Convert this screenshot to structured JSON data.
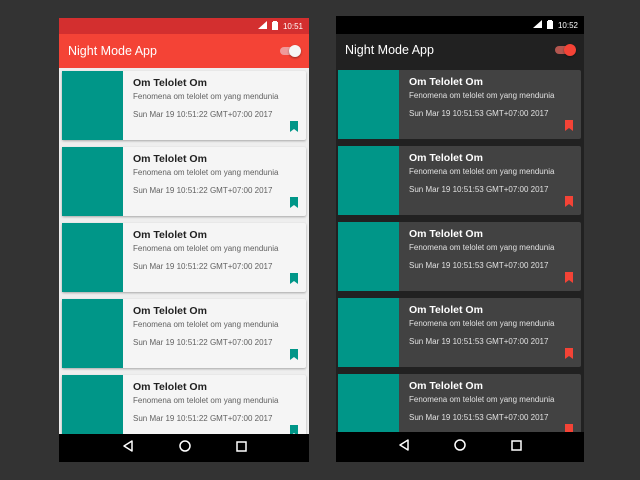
{
  "light": {
    "status_time": "10:51",
    "app_title": "Night Mode App",
    "cards": [
      {
        "title": "Om Telolet Om",
        "desc": "Fenomena om telolet om yang mendunia",
        "date": "Sun Mar 19 10:51:22 GMT+07:00 2017"
      },
      {
        "title": "Om Telolet Om",
        "desc": "Fenomena om telolet om yang mendunia",
        "date": "Sun Mar 19 10:51:22 GMT+07:00 2017"
      },
      {
        "title": "Om Telolet Om",
        "desc": "Fenomena om telolet om yang mendunia",
        "date": "Sun Mar 19 10:51:22 GMT+07:00 2017"
      },
      {
        "title": "Om Telolet Om",
        "desc": "Fenomena om telolet om yang mendunia",
        "date": "Sun Mar 19 10:51:22 GMT+07:00 2017"
      },
      {
        "title": "Om Telolet Om",
        "desc": "Fenomena om telolet om yang mendunia",
        "date": "Sun Mar 19 10:51:22 GMT+07:00 2017"
      }
    ]
  },
  "dark": {
    "status_time": "10:52",
    "app_title": "Night Mode App",
    "cards": [
      {
        "title": "Om Telolet Om",
        "desc": "Fenomena om telolet om yang mendunia",
        "date": "Sun Mar 19 10:51:53 GMT+07:00 2017"
      },
      {
        "title": "Om Telolet Om",
        "desc": "Fenomena om telolet om yang mendunia",
        "date": "Sun Mar 19 10:51:53 GMT+07:00 2017"
      },
      {
        "title": "Om Telolet Om",
        "desc": "Fenomena om telolet om yang mendunia",
        "date": "Sun Mar 19 10:51:53 GMT+07:00 2017"
      },
      {
        "title": "Om Telolet Om",
        "desc": "Fenomena om telolet om yang mendunia",
        "date": "Sun Mar 19 10:51:53 GMT+07:00 2017"
      },
      {
        "title": "Om Telolet Om",
        "desc": "Fenomena om telolet om yang mendunia",
        "date": "Sun Mar 19 10:51:53 GMT+07:00 2017"
      }
    ]
  },
  "colors": {
    "light_appbar": "#f44336",
    "light_statusbar": "#d32f2f",
    "dark_background": "#212121",
    "dark_card": "#424242",
    "card_image": "#009688",
    "light_bookmark": "#009688",
    "dark_bookmark": "#f44336"
  },
  "icons": {
    "status": [
      "network-icon",
      "battery-icon"
    ],
    "card": "bookmark-icon",
    "nav": [
      "back-icon",
      "home-icon",
      "recent-apps-icon"
    ]
  }
}
